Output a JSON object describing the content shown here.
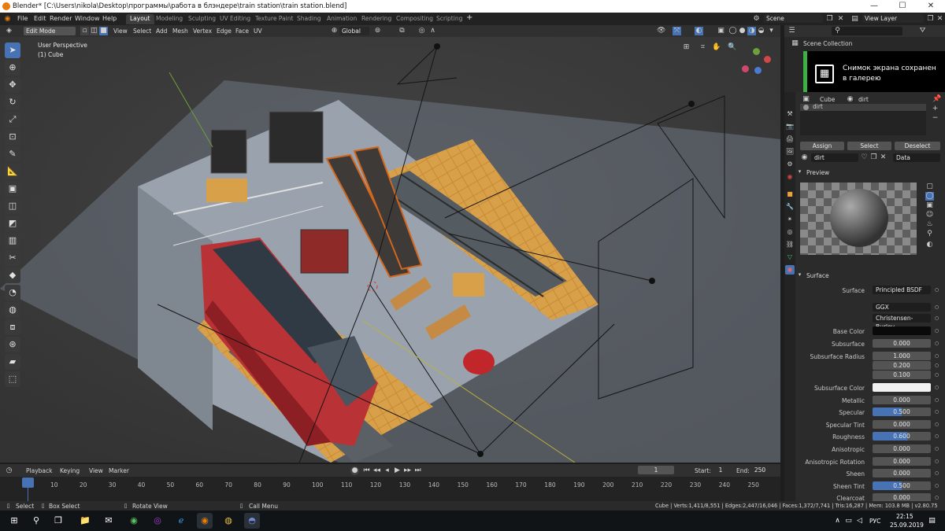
{
  "app": {
    "title": "Blender* [C:\\Users\\nikola\\Desktop\\программы\\работа в блэндере\\train station\\train station.blend]",
    "window_buttons": [
      "—",
      "☐",
      "✕"
    ]
  },
  "menu": {
    "items": [
      "File",
      "Edit",
      "Render",
      "Window",
      "Help"
    ],
    "workspaces": [
      "Layout",
      "Modeling",
      "Sculpting",
      "UV Editing",
      "Texture Paint",
      "Shading",
      "Animation",
      "Rendering",
      "Compositing",
      "Scripting"
    ],
    "add_tab": "+",
    "scene": "Scene",
    "view_layer": "View Layer"
  },
  "viewport_header": {
    "mode": "Edit Mode",
    "menus": [
      "View",
      "Select",
      "Add",
      "Mesh",
      "Vertex",
      "Edge",
      "Face",
      "UV"
    ],
    "orientation": "Global"
  },
  "viewport": {
    "perspective": "User Perspective",
    "object": "(1) Cube"
  },
  "tools": [
    "select",
    "cursor",
    "move",
    "rotate",
    "scale",
    "transform",
    "annotate",
    "measure",
    "extrude",
    "inset",
    "bevel",
    "loop-cut",
    "knife",
    "poly-build",
    "spin",
    "smooth",
    "edge-slide",
    "shrink-fatten",
    "shear",
    "rip"
  ],
  "outliner": {
    "title": "Scene Collection"
  },
  "toast": {
    "line1": "Снимок экрана сохранен",
    "line2": "в галерею"
  },
  "properties": {
    "object": "Cube",
    "material": "dirt",
    "slot": "dirt",
    "buttons": [
      "Assign",
      "Select",
      "Deselect"
    ],
    "material_name": "dirt",
    "link": "Data",
    "preview_label": "Preview",
    "surface_label": "Surface",
    "rows": [
      {
        "label": "Surface",
        "value": "Principled BSDF",
        "kind": "dark"
      },
      {
        "label": "",
        "value": "GGX",
        "kind": "dark"
      },
      {
        "label": "",
        "value": "Christensen-Burley",
        "kind": "dark"
      },
      {
        "label": "Base Color",
        "value": "",
        "kind": "color-dark"
      },
      {
        "label": "Subsurface",
        "value": "0.000",
        "kind": "num"
      },
      {
        "label": "Subsurface Radius",
        "value": "1.000",
        "kind": "num"
      },
      {
        "label": "",
        "value": "0.200",
        "kind": "num"
      },
      {
        "label": "",
        "value": "0.100",
        "kind": "num"
      },
      {
        "label": "Subsurface Color",
        "value": "",
        "kind": "color-light"
      },
      {
        "label": "Metallic",
        "value": "0.000",
        "kind": "num"
      },
      {
        "label": "Specular",
        "value": "0.500",
        "kind": "blue",
        "fill": 0.5
      },
      {
        "label": "Specular Tint",
        "value": "0.000",
        "kind": "num"
      },
      {
        "label": "Roughness",
        "value": "0.600",
        "kind": "blue",
        "fill": 0.6
      },
      {
        "label": "Anisotropic",
        "value": "0.000",
        "kind": "num"
      },
      {
        "label": "Anisotropic Rotation",
        "value": "0.000",
        "kind": "num"
      },
      {
        "label": "Sheen",
        "value": "0.000",
        "kind": "num"
      },
      {
        "label": "Sheen Tint",
        "value": "0.500",
        "kind": "blue",
        "fill": 0.5
      },
      {
        "label": "Clearcoat",
        "value": "0.000",
        "kind": "num"
      }
    ]
  },
  "timeline": {
    "menus": [
      "Playback",
      "Keying",
      "View",
      "Marker"
    ],
    "current_frame": "1",
    "start_label": "Start:",
    "start": "1",
    "end_label": "End:",
    "end": "250",
    "ticks": [
      "1",
      "10",
      "20",
      "30",
      "40",
      "50",
      "60",
      "70",
      "80",
      "90",
      "100",
      "110",
      "120",
      "130",
      "140",
      "150",
      "160",
      "170",
      "180",
      "190",
      "200",
      "210",
      "220",
      "230",
      "240",
      "250"
    ]
  },
  "statusbar": {
    "select": "Select",
    "box_select": "Box Select",
    "rotate_view": "Rotate View",
    "call_menu": "Call Menu",
    "stats": "Cube | Verts:1,411/8,551 | Edges:2,447/16,046 | Faces:1,372/7,741 | Tris:16,287 | Mem: 103.8 MB | v2.80.75"
  },
  "taskbar": {
    "lang": "РУС",
    "time": "22:15",
    "date": "25.09.2019"
  },
  "colors": {
    "accent": "#4772b3",
    "toast_green": "#3cb043"
  }
}
